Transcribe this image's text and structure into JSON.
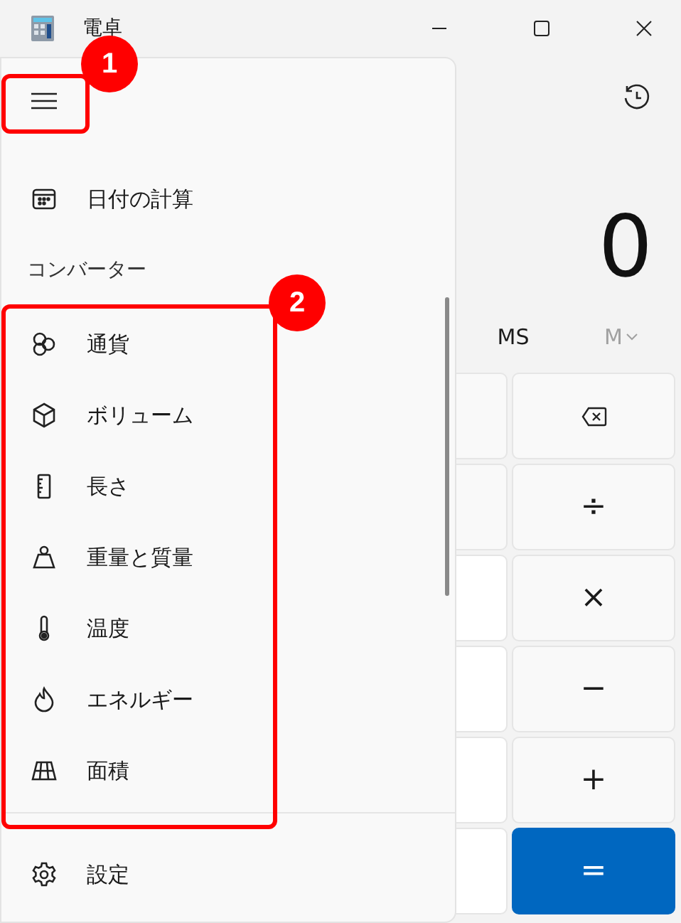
{
  "window": {
    "title": "電卓"
  },
  "display": {
    "value": "0"
  },
  "memory": [
    {
      "label": "MS",
      "disabled": false
    },
    {
      "label": "M",
      "disabled": true
    }
  ],
  "keys": [
    {
      "kind": "backspace"
    },
    {
      "kind": "text",
      "label": "÷"
    },
    {
      "kind": "text",
      "label": "×"
    },
    {
      "kind": "text",
      "label": "−"
    },
    {
      "kind": "text",
      "label": "+"
    },
    {
      "kind": "equals",
      "label": "="
    }
  ],
  "nav": {
    "items": [
      {
        "kind": "item",
        "label": "日付の計算"
      },
      {
        "kind": "header",
        "label": "コンバーター"
      },
      {
        "kind": "item",
        "label": "通貨"
      },
      {
        "kind": "item",
        "label": "ボリューム"
      },
      {
        "kind": "item",
        "label": "長さ"
      },
      {
        "kind": "item",
        "label": "重量と質量"
      },
      {
        "kind": "item",
        "label": "温度"
      },
      {
        "kind": "item",
        "label": "エネルギー"
      },
      {
        "kind": "item",
        "label": "面積"
      }
    ],
    "footer": {
      "label": "設定"
    }
  },
  "annotations": [
    {
      "label": "1"
    },
    {
      "label": "2"
    }
  ]
}
